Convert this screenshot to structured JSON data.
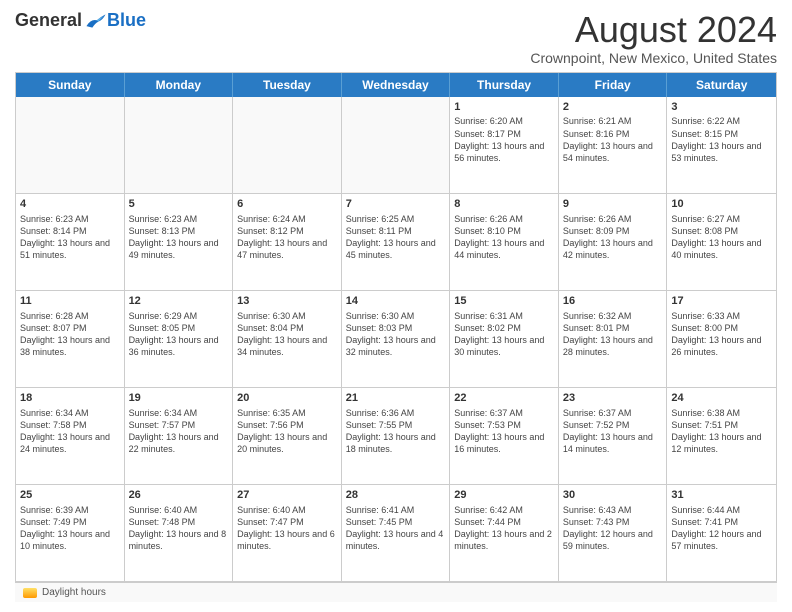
{
  "logo": {
    "general": "General",
    "blue": "Blue"
  },
  "title": "August 2024",
  "subtitle": "Crownpoint, New Mexico, United States",
  "days_of_week": [
    "Sunday",
    "Monday",
    "Tuesday",
    "Wednesday",
    "Thursday",
    "Friday",
    "Saturday"
  ],
  "legend_label": "Daylight hours",
  "weeks": [
    [
      {
        "day": "",
        "sunrise": "",
        "sunset": "",
        "daylight": ""
      },
      {
        "day": "",
        "sunrise": "",
        "sunset": "",
        "daylight": ""
      },
      {
        "day": "",
        "sunrise": "",
        "sunset": "",
        "daylight": ""
      },
      {
        "day": "",
        "sunrise": "",
        "sunset": "",
        "daylight": ""
      },
      {
        "day": "1",
        "sunrise": "Sunrise: 6:20 AM",
        "sunset": "Sunset: 8:17 PM",
        "daylight": "Daylight: 13 hours and 56 minutes."
      },
      {
        "day": "2",
        "sunrise": "Sunrise: 6:21 AM",
        "sunset": "Sunset: 8:16 PM",
        "daylight": "Daylight: 13 hours and 54 minutes."
      },
      {
        "day": "3",
        "sunrise": "Sunrise: 6:22 AM",
        "sunset": "Sunset: 8:15 PM",
        "daylight": "Daylight: 13 hours and 53 minutes."
      }
    ],
    [
      {
        "day": "4",
        "sunrise": "Sunrise: 6:23 AM",
        "sunset": "Sunset: 8:14 PM",
        "daylight": "Daylight: 13 hours and 51 minutes."
      },
      {
        "day": "5",
        "sunrise": "Sunrise: 6:23 AM",
        "sunset": "Sunset: 8:13 PM",
        "daylight": "Daylight: 13 hours and 49 minutes."
      },
      {
        "day": "6",
        "sunrise": "Sunrise: 6:24 AM",
        "sunset": "Sunset: 8:12 PM",
        "daylight": "Daylight: 13 hours and 47 minutes."
      },
      {
        "day": "7",
        "sunrise": "Sunrise: 6:25 AM",
        "sunset": "Sunset: 8:11 PM",
        "daylight": "Daylight: 13 hours and 45 minutes."
      },
      {
        "day": "8",
        "sunrise": "Sunrise: 6:26 AM",
        "sunset": "Sunset: 8:10 PM",
        "daylight": "Daylight: 13 hours and 44 minutes."
      },
      {
        "day": "9",
        "sunrise": "Sunrise: 6:26 AM",
        "sunset": "Sunset: 8:09 PM",
        "daylight": "Daylight: 13 hours and 42 minutes."
      },
      {
        "day": "10",
        "sunrise": "Sunrise: 6:27 AM",
        "sunset": "Sunset: 8:08 PM",
        "daylight": "Daylight: 13 hours and 40 minutes."
      }
    ],
    [
      {
        "day": "11",
        "sunrise": "Sunrise: 6:28 AM",
        "sunset": "Sunset: 8:07 PM",
        "daylight": "Daylight: 13 hours and 38 minutes."
      },
      {
        "day": "12",
        "sunrise": "Sunrise: 6:29 AM",
        "sunset": "Sunset: 8:05 PM",
        "daylight": "Daylight: 13 hours and 36 minutes."
      },
      {
        "day": "13",
        "sunrise": "Sunrise: 6:30 AM",
        "sunset": "Sunset: 8:04 PM",
        "daylight": "Daylight: 13 hours and 34 minutes."
      },
      {
        "day": "14",
        "sunrise": "Sunrise: 6:30 AM",
        "sunset": "Sunset: 8:03 PM",
        "daylight": "Daylight: 13 hours and 32 minutes."
      },
      {
        "day": "15",
        "sunrise": "Sunrise: 6:31 AM",
        "sunset": "Sunset: 8:02 PM",
        "daylight": "Daylight: 13 hours and 30 minutes."
      },
      {
        "day": "16",
        "sunrise": "Sunrise: 6:32 AM",
        "sunset": "Sunset: 8:01 PM",
        "daylight": "Daylight: 13 hours and 28 minutes."
      },
      {
        "day": "17",
        "sunrise": "Sunrise: 6:33 AM",
        "sunset": "Sunset: 8:00 PM",
        "daylight": "Daylight: 13 hours and 26 minutes."
      }
    ],
    [
      {
        "day": "18",
        "sunrise": "Sunrise: 6:34 AM",
        "sunset": "Sunset: 7:58 PM",
        "daylight": "Daylight: 13 hours and 24 minutes."
      },
      {
        "day": "19",
        "sunrise": "Sunrise: 6:34 AM",
        "sunset": "Sunset: 7:57 PM",
        "daylight": "Daylight: 13 hours and 22 minutes."
      },
      {
        "day": "20",
        "sunrise": "Sunrise: 6:35 AM",
        "sunset": "Sunset: 7:56 PM",
        "daylight": "Daylight: 13 hours and 20 minutes."
      },
      {
        "day": "21",
        "sunrise": "Sunrise: 6:36 AM",
        "sunset": "Sunset: 7:55 PM",
        "daylight": "Daylight: 13 hours and 18 minutes."
      },
      {
        "day": "22",
        "sunrise": "Sunrise: 6:37 AM",
        "sunset": "Sunset: 7:53 PM",
        "daylight": "Daylight: 13 hours and 16 minutes."
      },
      {
        "day": "23",
        "sunrise": "Sunrise: 6:37 AM",
        "sunset": "Sunset: 7:52 PM",
        "daylight": "Daylight: 13 hours and 14 minutes."
      },
      {
        "day": "24",
        "sunrise": "Sunrise: 6:38 AM",
        "sunset": "Sunset: 7:51 PM",
        "daylight": "Daylight: 13 hours and 12 minutes."
      }
    ],
    [
      {
        "day": "25",
        "sunrise": "Sunrise: 6:39 AM",
        "sunset": "Sunset: 7:49 PM",
        "daylight": "Daylight: 13 hours and 10 minutes."
      },
      {
        "day": "26",
        "sunrise": "Sunrise: 6:40 AM",
        "sunset": "Sunset: 7:48 PM",
        "daylight": "Daylight: 13 hours and 8 minutes."
      },
      {
        "day": "27",
        "sunrise": "Sunrise: 6:40 AM",
        "sunset": "Sunset: 7:47 PM",
        "daylight": "Daylight: 13 hours and 6 minutes."
      },
      {
        "day": "28",
        "sunrise": "Sunrise: 6:41 AM",
        "sunset": "Sunset: 7:45 PM",
        "daylight": "Daylight: 13 hours and 4 minutes."
      },
      {
        "day": "29",
        "sunrise": "Sunrise: 6:42 AM",
        "sunset": "Sunset: 7:44 PM",
        "daylight": "Daylight: 13 hours and 2 minutes."
      },
      {
        "day": "30",
        "sunrise": "Sunrise: 6:43 AM",
        "sunset": "Sunset: 7:43 PM",
        "daylight": "Daylight: 12 hours and 59 minutes."
      },
      {
        "day": "31",
        "sunrise": "Sunrise: 6:44 AM",
        "sunset": "Sunset: 7:41 PM",
        "daylight": "Daylight: 12 hours and 57 minutes."
      }
    ]
  ]
}
